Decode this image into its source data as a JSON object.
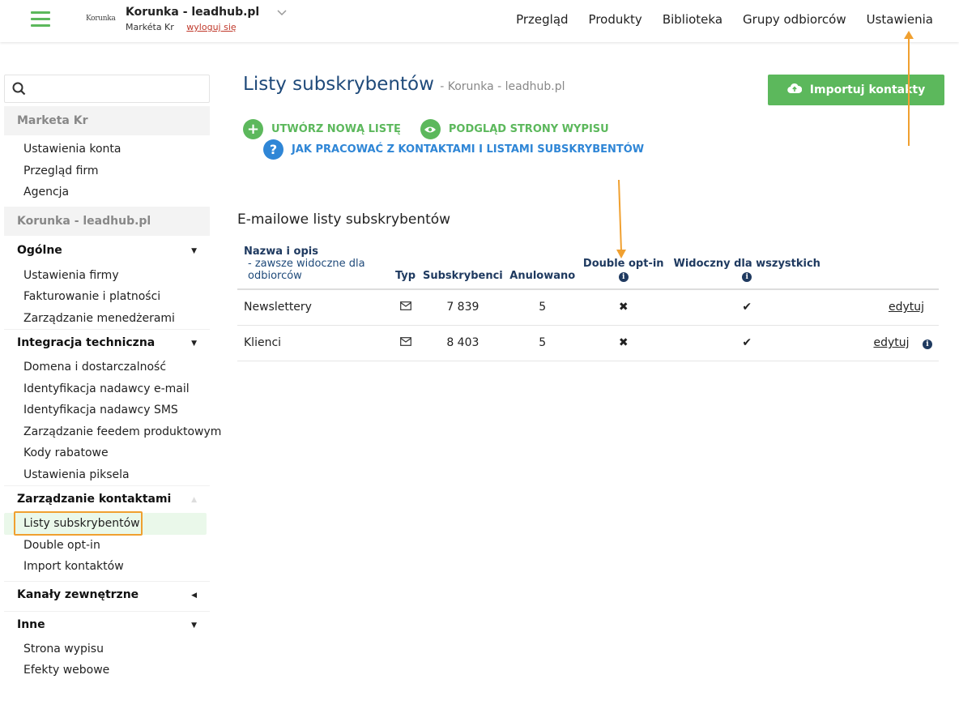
{
  "header": {
    "logo_text": "Korunka",
    "account_name": "Korunka - leadhub.pl",
    "user": "Markéta Kr",
    "logout": "wyloguj się",
    "nav": [
      "Przegląd",
      "Produkty",
      "Biblioteka",
      "Grupy odbiorców",
      "Ustawienia"
    ]
  },
  "sidebar": {
    "search_placeholder": "",
    "user_group": "Marketa Kr",
    "user_items": [
      "Ustawienia konta",
      "Przegląd firm",
      "Agencja"
    ],
    "company_group": "Korunka - leadhub.pl",
    "sections": [
      {
        "title": "Ogólne",
        "items": [
          "Ustawienia firmy",
          "Fakturowanie i platności",
          "Zarządzanie menedżerami"
        ]
      },
      {
        "title": "Integracja techniczna",
        "items": [
          "Domena i dostarczalność",
          "Identyfikacja nadawcy e-mail",
          "Identyfikacja nadawcy SMS",
          "Zarządzanie feedem produktowym",
          "Kody rabatowe",
          "Ustawienia piksela"
        ]
      },
      {
        "title": "Zarządzanie kontaktami",
        "items": [
          "Listy subskrybentów",
          "Double opt-in",
          "Import kontaktów"
        ]
      },
      {
        "title": "Kanały zewnętrzne",
        "items": []
      },
      {
        "title": "Inne",
        "items": [
          "Strona wypisu",
          "Efekty webowe"
        ]
      }
    ]
  },
  "main": {
    "title": "Listy subskrybentów",
    "subtitle": "- Korunka - leadhub.pl",
    "import_button": "Importuj kontakty",
    "action_create": "UTWÓRZ NOWĄ LISTĘ",
    "action_preview": "PODGLĄD STRONY WYPISU",
    "action_help": "JAK PRACOWAĆ Z KONTAKTAMI I LISTAMI SUBSKRYBENTÓW",
    "section_title": "E-mailowe listy subskrybentów",
    "columns": {
      "name": "Nazwa i opis",
      "name_desc": "- zawsze widoczne dla odbiorców",
      "type": "Typ",
      "subscribers": "Subskrybenci",
      "cancelled": "Anulowano",
      "double_optin": "Double opt-in",
      "visible": "Widoczny dla wszystkich"
    },
    "rows": [
      {
        "name": "Newslettery",
        "subscribers": "7 839",
        "cancelled": "5",
        "edit": "edytuj"
      },
      {
        "name": "Klienci",
        "subscribers": "8 403",
        "cancelled": "5",
        "edit": "edytuj"
      }
    ]
  },
  "colors": {
    "accent_green": "#5cb85c",
    "link_blue": "#2f86d6",
    "highlight_orange": "#f0a030"
  }
}
